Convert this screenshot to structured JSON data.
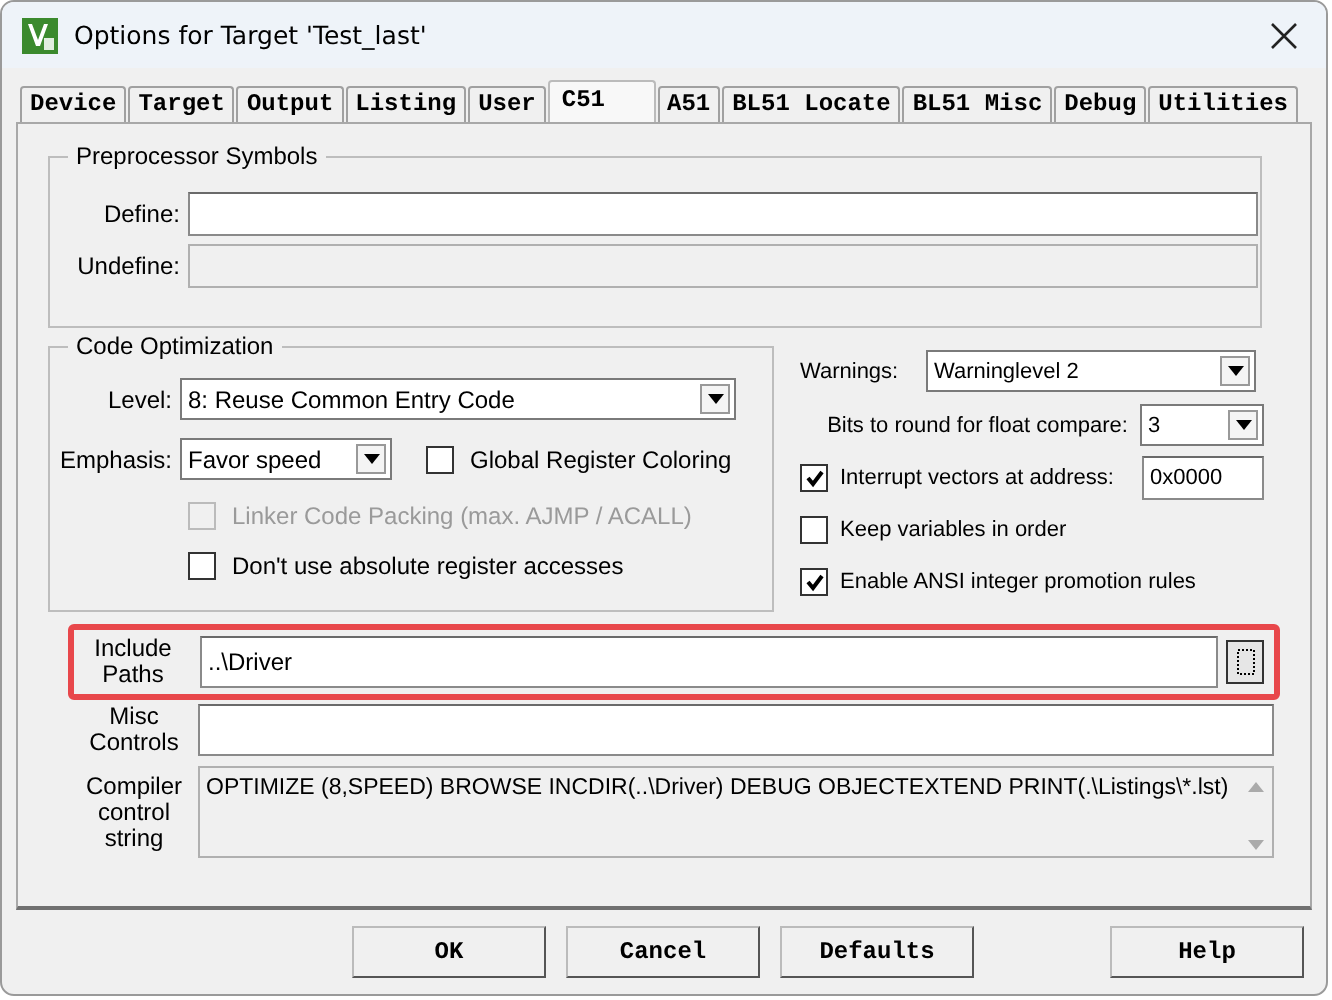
{
  "window": {
    "title": "Options for Target 'Test_last'"
  },
  "tabs": [
    {
      "label": "Device",
      "selected": false
    },
    {
      "label": "Target",
      "selected": false
    },
    {
      "label": "Output",
      "selected": false
    },
    {
      "label": "Listing",
      "selected": false
    },
    {
      "label": "User",
      "selected": false
    },
    {
      "label": "C51",
      "selected": true
    },
    {
      "label": "A51",
      "selected": false
    },
    {
      "label": "BL51 Locate",
      "selected": false
    },
    {
      "label": "BL51 Misc",
      "selected": false
    },
    {
      "label": "Debug",
      "selected": false
    },
    {
      "label": "Utilities",
      "selected": false
    }
  ],
  "preprocessor": {
    "title": "Preprocessor Symbols",
    "fields": [
      {
        "label": "Define:",
        "disabled": false
      },
      {
        "label": "Undefine:",
        "disabled": true
      }
    ]
  },
  "optimization": {
    "title": "Code Optimization",
    "level": {
      "label": "Level:",
      "value": "8: Reuse Common Entry Code"
    },
    "emphasis": {
      "label": "Emphasis:",
      "value": "Favor speed"
    },
    "checkboxes": [
      {
        "label": "Global Register Coloring",
        "checked": false,
        "disabled": false
      },
      {
        "label": "Linker Code Packing (max. AJMP / ACALL)",
        "checked": false,
        "disabled": true
      },
      {
        "label": "Don't use absolute register accesses",
        "checked": false,
        "disabled": false
      }
    ]
  },
  "options": [
    {
      "kind": "select",
      "label": "Warnings:",
      "value": "Warninglevel 2"
    },
    {
      "kind": "select",
      "label": "Bits to round for float compare:",
      "value": "3"
    },
    {
      "kind": "checkbox-field",
      "label": "Interrupt vectors at address:",
      "checked": true,
      "value": "0x0000"
    },
    {
      "kind": "checkbox",
      "label": "Keep variables in order",
      "checked": false
    },
    {
      "kind": "checkbox",
      "label": "Enable ANSI integer promotion rules",
      "checked": true
    }
  ],
  "include_paths": {
    "label": "Include Paths",
    "value": "..\\Driver",
    "highlighted": true
  },
  "misc_controls": {
    "label": "Misc Controls"
  },
  "control_string": {
    "label": "Compiler control string",
    "value": "OPTIMIZE (8,SPEED) BROWSE INCDIR(..\\Driver) DEBUG OBJECTEXTEND PRINT(.\\Listings\\*.lst)"
  },
  "buttons": [
    {
      "label": "OK"
    },
    {
      "label": "Cancel"
    },
    {
      "label": "Defaults"
    },
    {
      "label": "Help"
    }
  ]
}
